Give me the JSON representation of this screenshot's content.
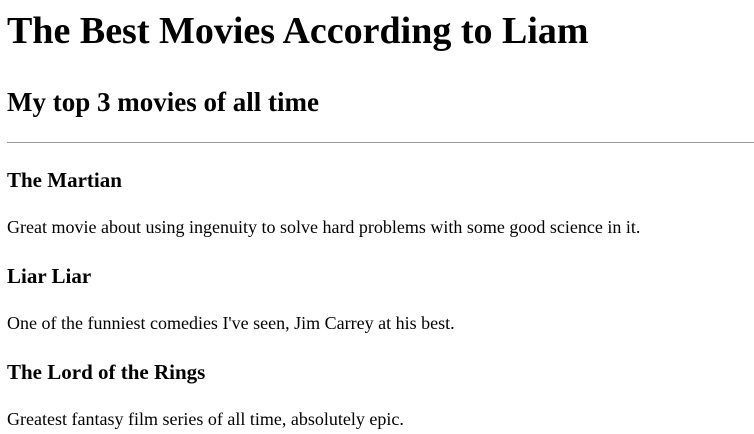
{
  "page": {
    "title": "The Best Movies According to Liam",
    "subtitle": "My top 3 movies of all time"
  },
  "movies": [
    {
      "title": "The Martian",
      "description": "Great movie about using ingenuity to solve hard problems with some good science in it."
    },
    {
      "title": "Liar Liar",
      "description": "One of the funniest comedies I've seen, Jim Carrey at his best."
    },
    {
      "title": "The Lord of the Rings",
      "description": "Greatest fantasy film series of all time, absolutely epic."
    }
  ]
}
